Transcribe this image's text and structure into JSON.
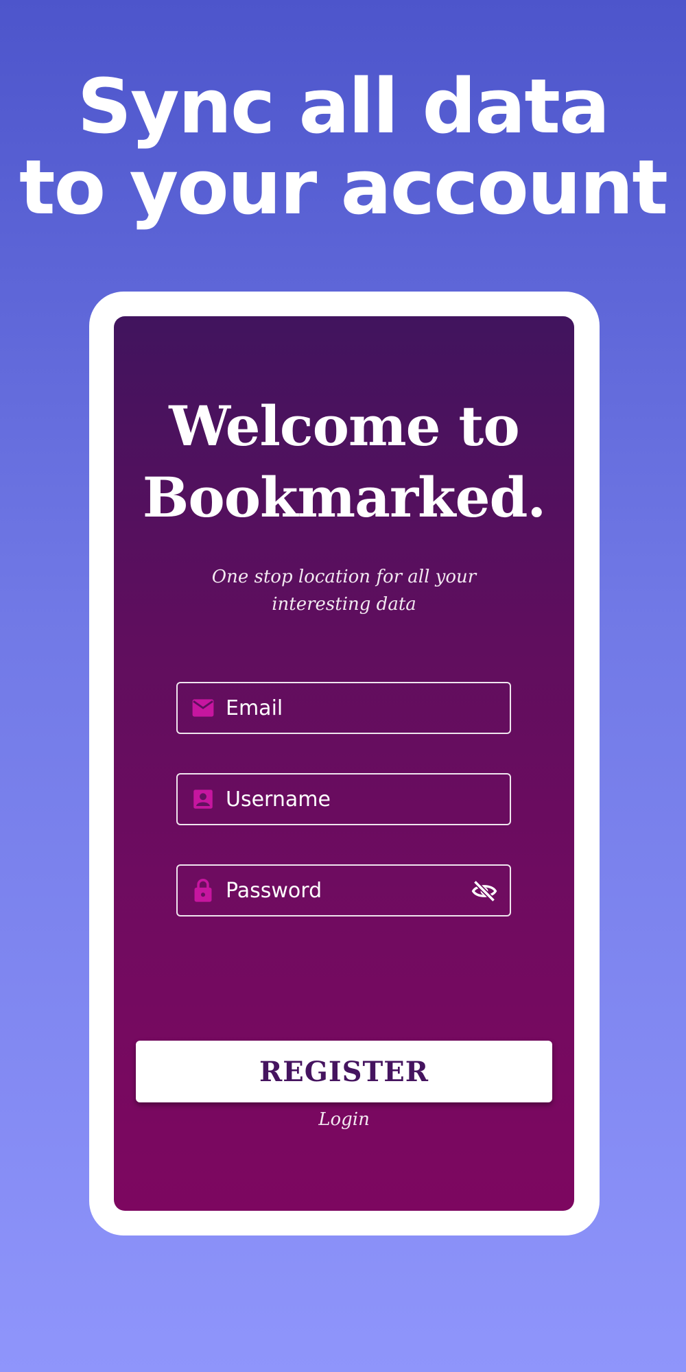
{
  "promo": {
    "headline_line1": "Sync all data",
    "headline_line2": "to your account"
  },
  "app": {
    "title_line1": "Welcome to",
    "title_line2": "Bookmarked.",
    "tagline_line1": "One stop location for all your",
    "tagline_line2": "interesting data"
  },
  "form": {
    "email": {
      "placeholder": "Email",
      "icon": "mail-icon"
    },
    "username": {
      "placeholder": "Username",
      "icon": "account-box-icon"
    },
    "password": {
      "placeholder": "Password",
      "icon": "lock-icon",
      "toggle_icon": "eye-off-icon"
    },
    "register_label": "REGISTER",
    "login_label": "Login"
  },
  "colors": {
    "icon_accent": "#c6169f",
    "background_top": "#4d55cb",
    "background_bottom": "#8f95fb",
    "screen_top": "#41145e",
    "screen_bottom": "#7d0760",
    "button_text": "#45145f"
  }
}
